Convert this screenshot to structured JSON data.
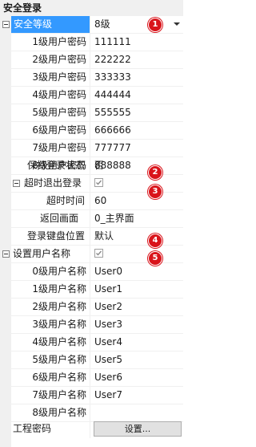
{
  "category": "安全登录",
  "security_level": {
    "label": "安全等级",
    "value": "8级",
    "badge": "1"
  },
  "passwords": [
    {
      "label": "1级用户密码",
      "value": "111111"
    },
    {
      "label": "2级用户密码",
      "value": "222222"
    },
    {
      "label": "3级用户密码",
      "value": "333333"
    },
    {
      "label": "4级用户密码",
      "value": "444444"
    },
    {
      "label": "5级用户密码",
      "value": "555555"
    },
    {
      "label": "6级用户密码",
      "value": "666666"
    },
    {
      "label": "7级用户密码",
      "value": "777777"
    },
    {
      "label": "8级用户密码",
      "value": "888888"
    }
  ],
  "keep_login": {
    "label": "保持登录状态",
    "value": "否",
    "badge": "2"
  },
  "timeout": {
    "label": "超时退出登录",
    "checked": true,
    "badge": "3",
    "time_label": "超时时间",
    "time_value": "60",
    "return_label": "返回画面",
    "return_value": "0_主界面"
  },
  "keyboard_pos": {
    "label": "登录键盘位置",
    "value": "默认",
    "badge": "4"
  },
  "set_username": {
    "label": "设置用户名称",
    "checked": true,
    "badge": "5"
  },
  "usernames": [
    {
      "label": "0级用户名称",
      "value": "User0"
    },
    {
      "label": "1级用户名称",
      "value": "User1"
    },
    {
      "label": "2级用户名称",
      "value": "User2"
    },
    {
      "label": "3级用户名称",
      "value": "User3"
    },
    {
      "label": "4级用户名称",
      "value": "User4"
    },
    {
      "label": "5级用户名称",
      "value": "User5"
    },
    {
      "label": "6级用户名称",
      "value": "User6"
    },
    {
      "label": "7级用户名称",
      "value": "User7"
    },
    {
      "label": "8级用户名称",
      "value": ""
    }
  ],
  "project_password": {
    "label": "工程密码",
    "button": "设置..."
  },
  "colors": {
    "badge": "#d9141b",
    "selected": "#3399ff",
    "gutter": "#f0f0f0"
  }
}
